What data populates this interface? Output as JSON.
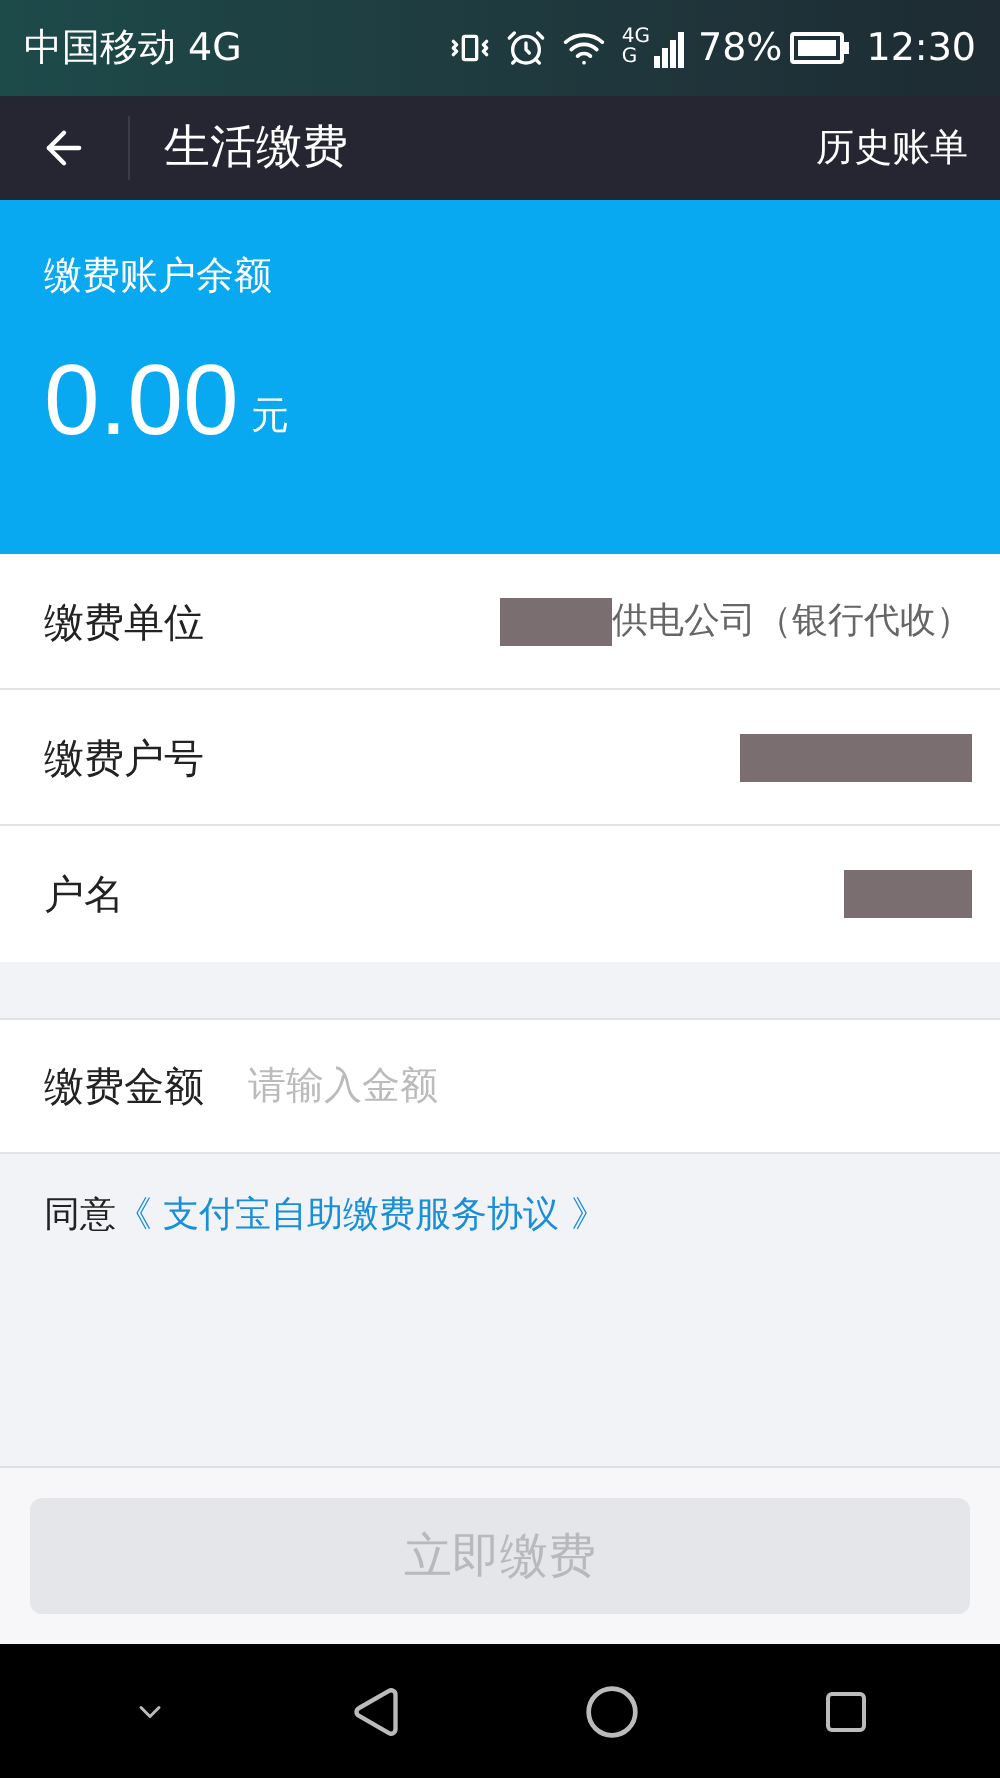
{
  "status_bar": {
    "carrier": "中国移动 4G",
    "network_badge_top": "4G",
    "network_badge_bottom": "G",
    "battery": "78%",
    "time": "12:30"
  },
  "header": {
    "title": "生活缴费",
    "action": "历史账单"
  },
  "balance": {
    "label": "缴费账户余额",
    "amount": "0.00",
    "unit": "元"
  },
  "rows": [
    {
      "label": "缴费单位",
      "value": "供电公司（银行代收）",
      "redacted": true
    },
    {
      "label": "缴费户号",
      "redacted": true
    },
    {
      "label": "户名",
      "redacted": true
    }
  ],
  "amount_field": {
    "label": "缴费金额",
    "placeholder": "请输入金额"
  },
  "agreement": {
    "prefix": "同意",
    "link": "《 支付宝自助缴费服务协议 》"
  },
  "submit": {
    "label": "立即缴费",
    "disabled": true
  }
}
